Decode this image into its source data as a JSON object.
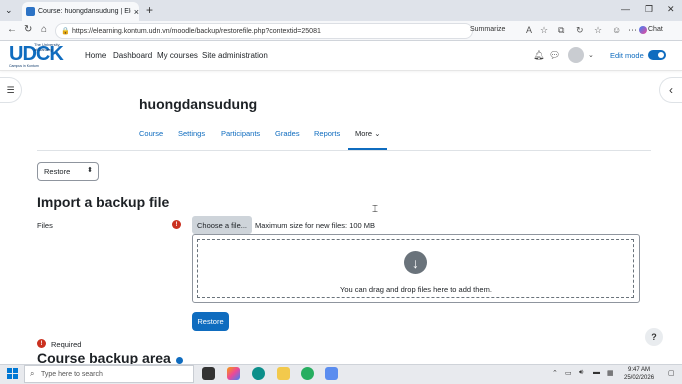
{
  "browser": {
    "tab_title": "Course: huongdansudung | Elearn",
    "url": "https://elearning.kontum.udn.vn/moodle/backup/restorefile.php?contextid=25081",
    "summarize_label": "Summarize",
    "copilot_label": "Chat"
  },
  "header": {
    "logo_main": "UDCK",
    "logo_line1": "The University",
    "logo_line2": "of Danang",
    "logo_sub": "Campus in Kontum",
    "nav": [
      "Home",
      "Dashboard",
      "My courses",
      "Site administration"
    ],
    "edit_mode_label": "Edit mode"
  },
  "course": {
    "title": "huongdansudung",
    "tabs": [
      "Course",
      "Settings",
      "Participants",
      "Grades",
      "Reports",
      "More"
    ]
  },
  "page": {
    "select_value": "Restore",
    "import_heading": "Import a backup file",
    "files_label": "Files",
    "choose_button": "Choose a file...",
    "max_size": "Maximum size for new files: 100 MB",
    "drop_text": "You can drag and drop files here to add them.",
    "restore_button": "Restore",
    "required_text": "Required",
    "backup_area_heading": "Course backup area",
    "help_label": "?"
  },
  "taskbar": {
    "search_placeholder": "Type here to search",
    "time": "9:47 AM",
    "date": "25/02/2026"
  },
  "colors": {
    "accent": "#0f6cbf",
    "required": "#ca3120"
  }
}
